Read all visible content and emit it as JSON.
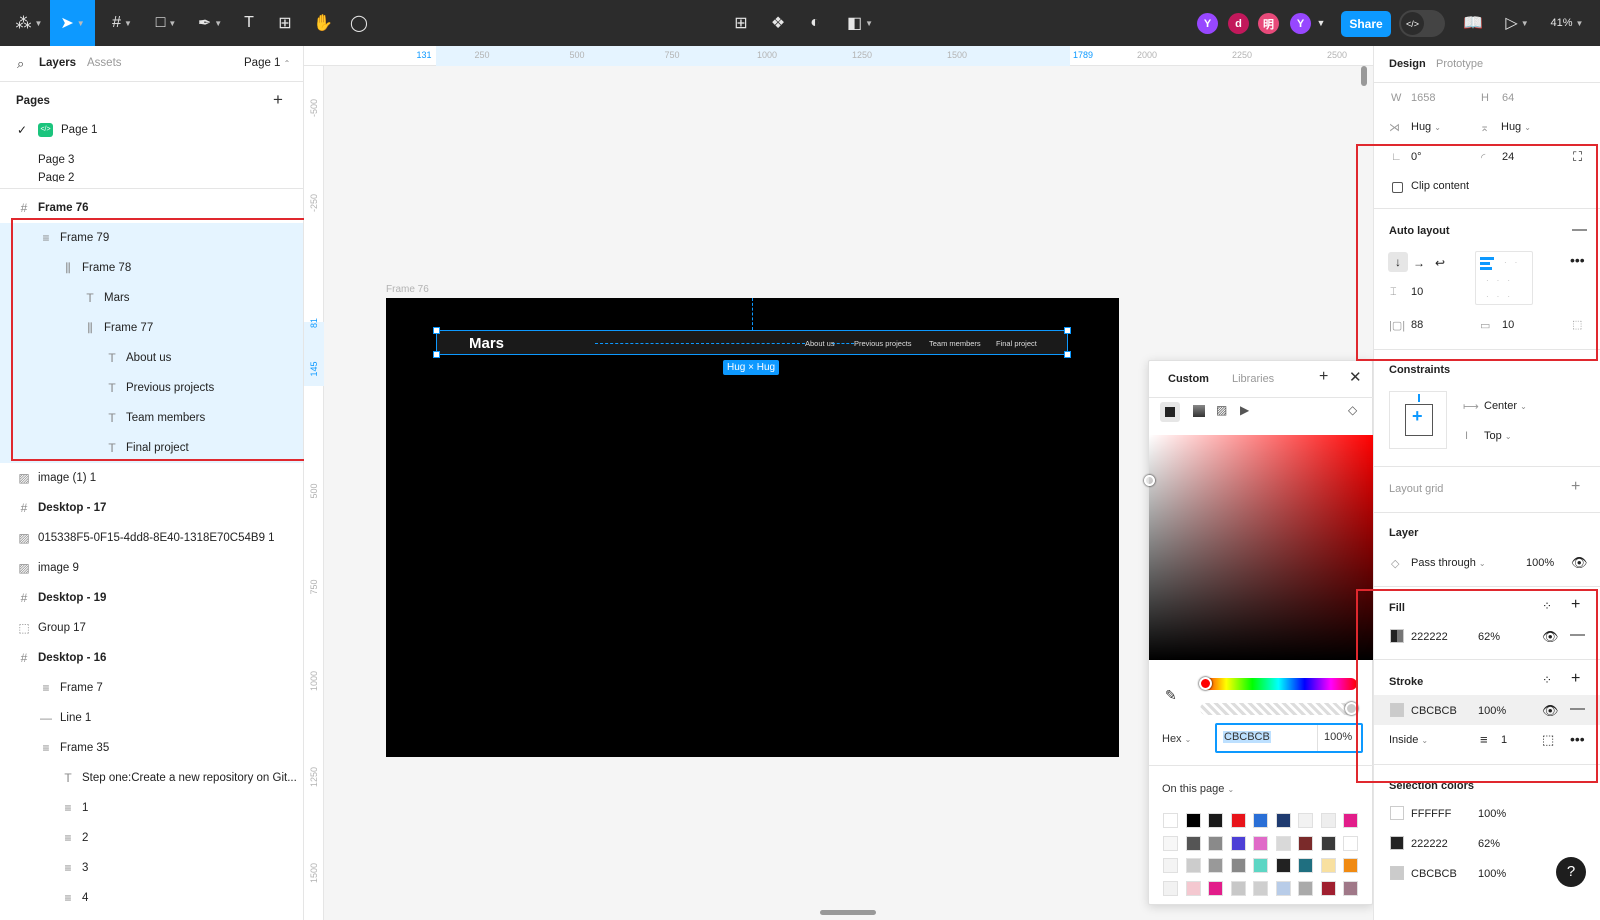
{
  "toolbar": {
    "zoom": "41%",
    "share_label": "Share",
    "avatars": [
      {
        "letter": "Y",
        "color": "#9747ff"
      },
      {
        "letter": "d",
        "color": "#c2185b"
      },
      {
        "letter": "明",
        "color": "#e84a7a"
      },
      {
        "letter": "Y",
        "color": "#9747ff"
      }
    ]
  },
  "left_panel": {
    "tab_layers": "Layers",
    "tab_assets": "Assets",
    "page_selector": "Page 1",
    "pages_title": "Pages",
    "pages": [
      "Page 1",
      "Page 3",
      "Page 2"
    ],
    "layers": [
      {
        "name": "Frame 76",
        "icon": "#",
        "indent": 0,
        "bold": true,
        "selected": false
      },
      {
        "name": "Frame 79",
        "icon": "≡",
        "indent": 1,
        "bold": false,
        "selected": true
      },
      {
        "name": "Frame 78",
        "icon": "⫼",
        "indent": 2,
        "bold": false,
        "selected": true
      },
      {
        "name": "Mars",
        "icon": "T",
        "indent": 3,
        "bold": false,
        "selected": true
      },
      {
        "name": "Frame 77",
        "icon": "⫼",
        "indent": 3,
        "bold": false,
        "selected": true
      },
      {
        "name": "About us",
        "icon": "T",
        "indent": 4,
        "bold": false,
        "selected": true
      },
      {
        "name": "Previous projects",
        "icon": "T",
        "indent": 4,
        "bold": false,
        "selected": true
      },
      {
        "name": "Team members",
        "icon": "T",
        "indent": 4,
        "bold": false,
        "selected": true
      },
      {
        "name": "Final project",
        "icon": "T",
        "indent": 4,
        "bold": false,
        "selected": true
      },
      {
        "name": "image (1) 1",
        "icon": "▨",
        "indent": 0,
        "bold": false,
        "selected": false
      },
      {
        "name": "Desktop - 17",
        "icon": "#",
        "indent": 0,
        "bold": true,
        "selected": false
      },
      {
        "name": "015338F5-0F15-4dd8-8E40-1318E70C54B9 1",
        "icon": "▨",
        "indent": 0,
        "bold": false,
        "selected": false
      },
      {
        "name": "image 9",
        "icon": "▨",
        "indent": 0,
        "bold": false,
        "selected": false
      },
      {
        "name": "Desktop - 19",
        "icon": "#",
        "indent": 0,
        "bold": true,
        "selected": false
      },
      {
        "name": "Group 17",
        "icon": "⬚",
        "indent": 0,
        "bold": false,
        "selected": false
      },
      {
        "name": "Desktop - 16",
        "icon": "#",
        "indent": 0,
        "bold": true,
        "selected": false
      },
      {
        "name": "Frame 7",
        "icon": "≡",
        "indent": 1,
        "bold": false,
        "selected": false
      },
      {
        "name": "Line 1",
        "icon": "—",
        "indent": 1,
        "bold": false,
        "selected": false
      },
      {
        "name": "Frame 35",
        "icon": "≡",
        "indent": 1,
        "bold": false,
        "selected": false
      },
      {
        "name": "Step one:Create a new repository on Git...",
        "icon": "T",
        "indent": 2,
        "bold": false,
        "selected": false
      },
      {
        "name": "1",
        "icon": "≡",
        "indent": 2,
        "bold": false,
        "selected": false
      },
      {
        "name": "2",
        "icon": "≡",
        "indent": 2,
        "bold": false,
        "selected": false
      },
      {
        "name": "3",
        "icon": "≡",
        "indent": 2,
        "bold": false,
        "selected": false
      },
      {
        "name": "4",
        "icon": "≡",
        "indent": 2,
        "bold": false,
        "selected": false
      }
    ]
  },
  "rulers": {
    "top": [
      "131",
      "250",
      "500",
      "750",
      "1000",
      "1250",
      "1500",
      "1789",
      "2000",
      "2250",
      "2500"
    ],
    "left": [
      "-500",
      "-250",
      "81",
      "145",
      "500",
      "750",
      "1000",
      "1250",
      "1500"
    ]
  },
  "canvas": {
    "frame_label": "Frame 76",
    "nav_title": "Mars",
    "nav_links": [
      "About us",
      "Previous projects",
      "Team members",
      "Final project"
    ],
    "size_badge": "Hug × Hug"
  },
  "color_picker": {
    "tab_custom": "Custom",
    "tab_libraries": "Libraries",
    "format": "Hex",
    "hex_value": "CBCBCB",
    "opacity": "100%",
    "on_this_page": "On this page",
    "swatches": [
      [
        "#ffffff",
        "#000000",
        "#1a1a1a",
        "#e8141a",
        "#2a6fd6",
        "#1f3b70",
        "#f2f2f2",
        "#eeeeee",
        "#e21d8a"
      ],
      [
        "#f7f7f7",
        "#555555",
        "#8a8a8a",
        "#4d3fd6",
        "#e06ac8",
        "#d9d9d9",
        "#7a2a2a",
        "#3a3a3a",
        "#ffffff"
      ],
      [
        "#f4f4f4",
        "#cccccc",
        "#999999",
        "#888888",
        "#5dd6c4",
        "#222222",
        "#1f6f80",
        "#f8e0a0",
        "#f08a12"
      ],
      [
        "#f2f2f2",
        "#f4c8d0",
        "#e21d8a",
        "#c8c8c8",
        "#cfcfcf",
        "#b8cce8",
        "#aaaaaa",
        "#a02030",
        "#a07888"
      ]
    ]
  },
  "design_panel": {
    "tab_design": "Design",
    "tab_prototype": "Prototype",
    "w_label": "W",
    "w_value": "1658",
    "h_label": "H",
    "h_value": "64",
    "width_mode": "Hug",
    "height_mode": "Hug",
    "rotation": "0°",
    "radius": "24",
    "clip_content": "Clip content",
    "auto_layout_title": "Auto layout",
    "gap": "10",
    "padding_h": "88",
    "padding_v": "10",
    "constraints_title": "Constraints",
    "constraint_h": "Center",
    "constraint_v": "Top",
    "layout_grid_title": "Layout grid",
    "layer_title": "Layer",
    "blend_mode": "Pass through",
    "layer_opacity": "100%",
    "fill_title": "Fill",
    "fill_hex": "222222",
    "fill_opacity": "62%",
    "stroke_title": "Stroke",
    "stroke_hex": "CBCBCB",
    "stroke_opacity": "100%",
    "stroke_position": "Inside",
    "stroke_weight": "1",
    "selection_colors_title": "Selection colors",
    "selection_colors": [
      {
        "hex": "FFFFFF",
        "opacity": "100%",
        "color": "#ffffff"
      },
      {
        "hex": "222222",
        "opacity": "62%",
        "color": "#222222"
      },
      {
        "hex": "CBCBCB",
        "opacity": "100%",
        "color": "#cbcbcb"
      }
    ],
    "help": "?"
  },
  "colors": {
    "accent": "#0d99ff",
    "toolbar_bg": "#2c2c2c",
    "annotation_red": "#e0282e",
    "selection_bg": "#e5f4ff"
  },
  "icons": [
    "figma-menu-icon",
    "move-tool-icon",
    "frame-tool-icon",
    "shape-tool-icon",
    "pen-tool-icon",
    "text-tool-icon",
    "resources-icon",
    "hand-tool-icon",
    "comment-icon",
    "grid-icon",
    "component-icon",
    "contrast-icon",
    "boolean-icon",
    "library-icon",
    "play-icon",
    "search-icon",
    "plus-icon",
    "close-icon",
    "eyedropper-icon",
    "eye-icon",
    "minus-icon"
  ]
}
